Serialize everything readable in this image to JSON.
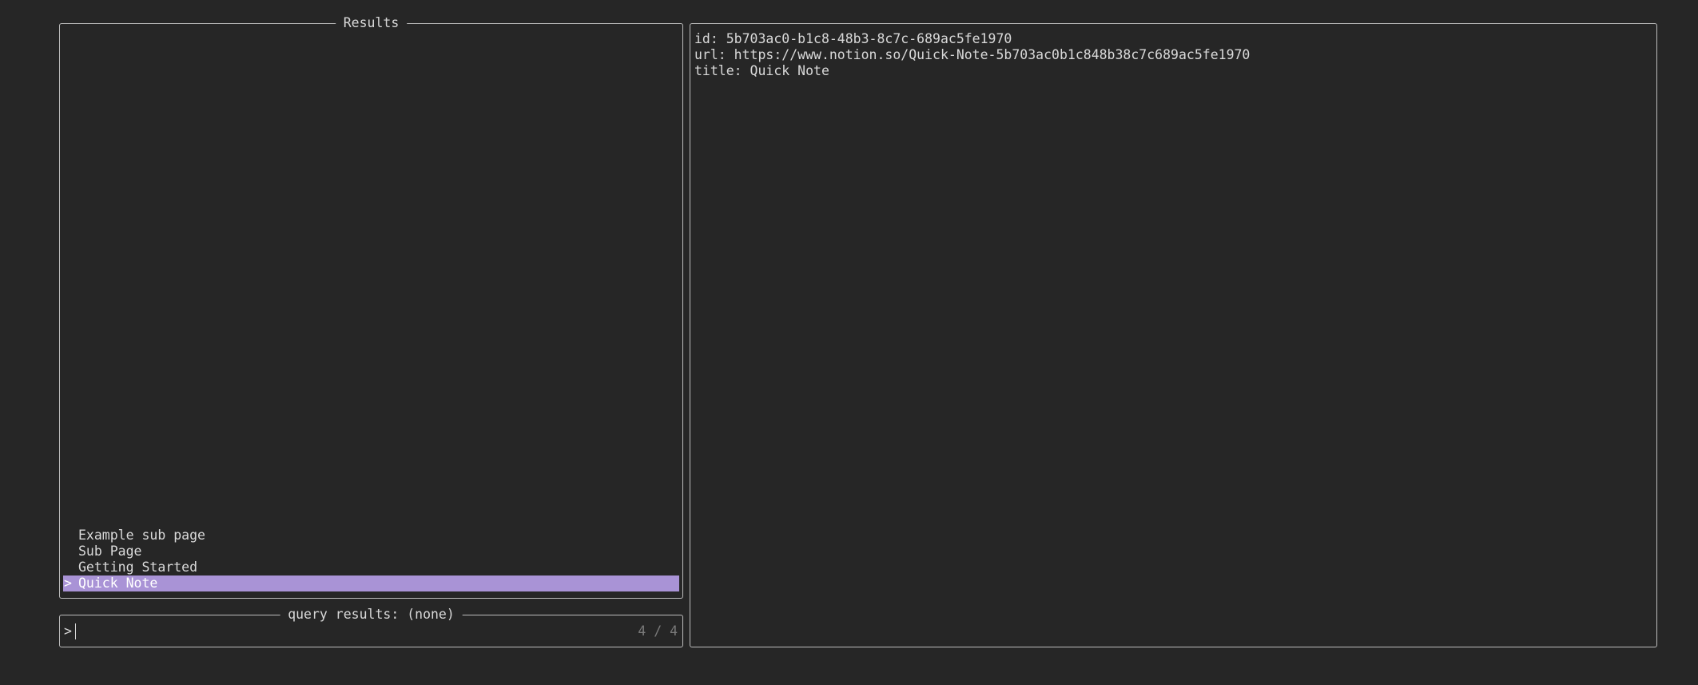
{
  "results": {
    "title": "Results",
    "items": [
      {
        "marker": "",
        "label": "Example sub page"
      },
      {
        "marker": "",
        "label": "Sub Page"
      },
      {
        "marker": "",
        "label": "Getting Started"
      },
      {
        "marker": ">",
        "label": "Quick Note",
        "selected": true
      }
    ]
  },
  "query": {
    "title": "query results: (none)",
    "prompt": ">",
    "value": "",
    "counter": "4 / 4"
  },
  "preview": {
    "lines": [
      "id: 5b703ac0-b1c8-48b3-8c7c-689ac5fe1970",
      "url: https://www.notion.so/Quick-Note-5b703ac0b1c848b38c7c689ac5fe1970",
      "title: Quick Note"
    ]
  },
  "colors": {
    "background": "#262626",
    "border": "#bdbdbd",
    "text": "#d8d8d8",
    "selection": "#a993d6",
    "muted": "#7a7a7a"
  }
}
